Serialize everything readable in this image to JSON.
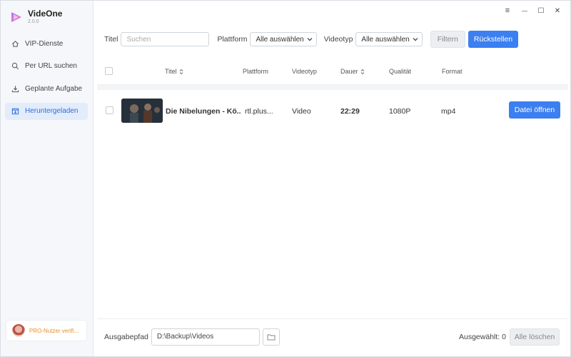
{
  "app": {
    "name": "VideOne",
    "version": "2.0.0"
  },
  "window_controls": {
    "menu": "≡",
    "minimize": "—",
    "maximize": "☐",
    "close": "✕"
  },
  "sidebar": {
    "items": [
      {
        "label": "VIP-Dienste",
        "icon": "home-icon",
        "active": false
      },
      {
        "label": "Per URL suchen",
        "icon": "search-icon",
        "active": false
      },
      {
        "label": "Geplante Aufgabe",
        "icon": "download-icon",
        "active": false
      },
      {
        "label": "Heruntergeladen",
        "icon": "downloaded-box-icon",
        "active": true
      }
    ],
    "pro_label": "PRO-Nutzer verifi..."
  },
  "filters": {
    "title_label": "Titel",
    "search_placeholder": "Suchen",
    "platform_label": "Plattform",
    "platform_value": "Alle auswählen",
    "videotype_label": "Videotyp",
    "videotype_value": "Alle auswählen",
    "filter_button": "Filtern",
    "reset_button": "Rückstellen"
  },
  "table": {
    "columns": {
      "title": "Titel",
      "platform": "Plattform",
      "videotype": "Videotyp",
      "duration": "Dauer",
      "quality": "Qualität",
      "format": "Format"
    },
    "rows": [
      {
        "title": "Die Nibelungen - Kö...",
        "platform": "rtl.plus...",
        "videotype": "Video",
        "duration": "22:29",
        "quality": "1080P",
        "format": "mp4",
        "action": "Datei öffnen"
      }
    ]
  },
  "footer": {
    "output_label": "Ausgabepfad",
    "output_path": "D:\\Backup\\Videos",
    "selected_label": "Ausgewählt: 0",
    "clear_button": "Alle löschen"
  },
  "colors": {
    "accent": "#3b7ff0",
    "pro": "#e6912d",
    "sidebar_active_bg": "#e3ecfb"
  }
}
